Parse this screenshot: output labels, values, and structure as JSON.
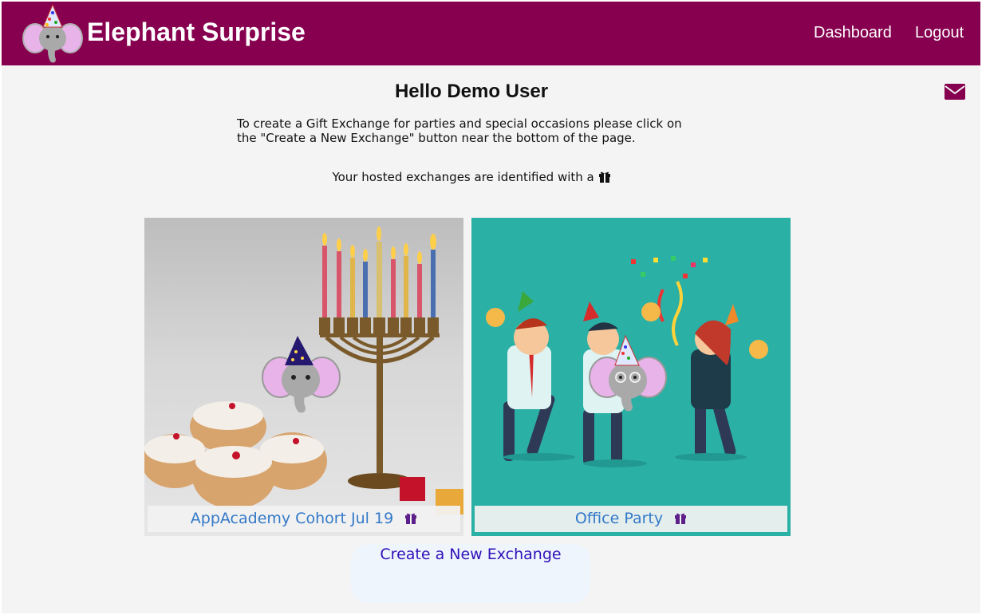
{
  "header": {
    "brand": "Elephant Surprise",
    "nav": {
      "dashboard": "Dashboard",
      "logout": "Logout"
    },
    "logo_icon": "party-elephant-logo",
    "bg_color": "#86004f"
  },
  "main": {
    "greeting": "Hello Demo User",
    "mail_icon": "envelope-icon",
    "intro": "To create a Gift Exchange for parties and special occasions please click on the \"Create a New Exchange\" button near the bottom of the page.",
    "hosted_note": "Your hosted exchanges are identified with a",
    "hosted_icon": "gift-icon"
  },
  "exchanges": [
    {
      "title": "AppAcademy Cohort Jul 19",
      "hosted": true,
      "image": "menorah-and-donuts-with-elephant"
    },
    {
      "title": "Office Party",
      "hosted": true,
      "image": "office-party-dancers-with-elephant"
    }
  ],
  "create_button": "Create a New Exchange",
  "colors": {
    "accent": "#86004f",
    "link": "#3479c8",
    "button_text": "#3010b8"
  }
}
